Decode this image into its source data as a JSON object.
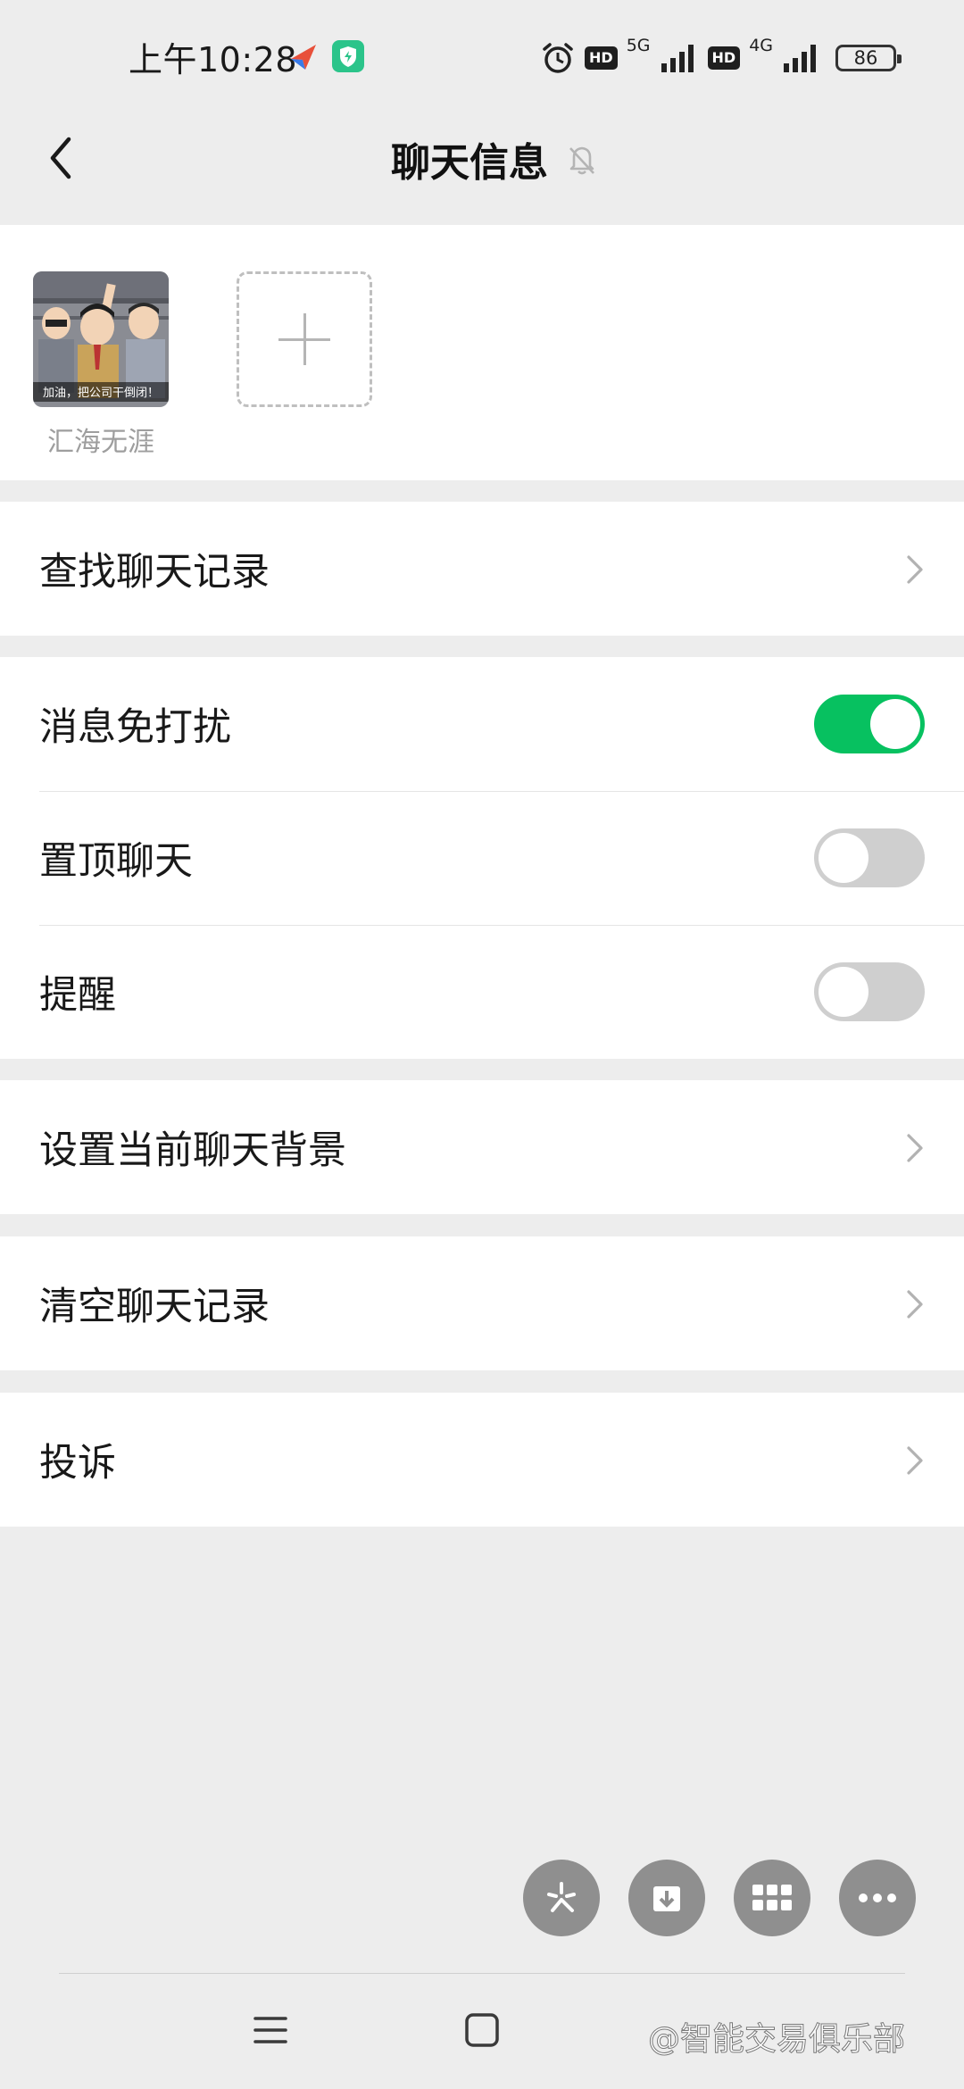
{
  "status_bar": {
    "time": "上午10:28",
    "hd_label": "HD",
    "network_5g": "5G",
    "network_4g": "4G",
    "battery_level": "86"
  },
  "header": {
    "title": "聊天信息",
    "back_icon": "chevron-left-icon",
    "mute_icon": "bell-off-icon"
  },
  "members": [
    {
      "name": "汇海无涯",
      "avatar_caption": "加油，把公司干倒闭！"
    }
  ],
  "rows": {
    "search_history": "查找聊天记录",
    "do_not_disturb": {
      "label": "消息免打扰",
      "enabled": true
    },
    "pin_chat": {
      "label": "置顶聊天",
      "enabled": false
    },
    "reminder": {
      "label": "提醒",
      "enabled": false
    },
    "set_background": "设置当前聊天背景",
    "clear_history": "清空聊天记录",
    "report": "投诉"
  },
  "floating_tools": [
    "sparkle-icon",
    "download-icon",
    "grid-icon",
    "more-icon"
  ],
  "nav_bar": [
    "menu-icon",
    "home-icon",
    "back-icon"
  ],
  "watermark": "@智能交易俱乐部",
  "colors": {
    "accent_green": "#07c160",
    "background": "#ededed"
  }
}
